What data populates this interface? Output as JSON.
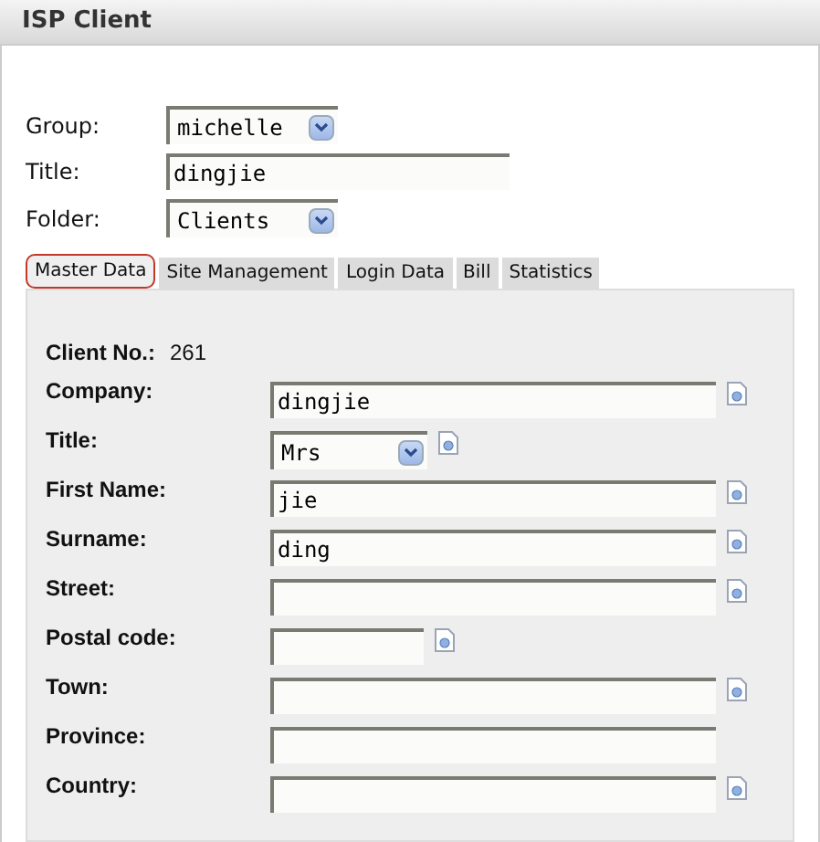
{
  "window": {
    "title": "ISP Client"
  },
  "top_fields": [
    {
      "kind": "select",
      "label": "Group:",
      "value": "michelle"
    },
    {
      "kind": "text",
      "label": "Title:",
      "value": "dingjie"
    },
    {
      "kind": "select",
      "label": "Folder:",
      "value": "Clients"
    }
  ],
  "tabs": [
    {
      "label": "Master Data",
      "selected": true
    },
    {
      "label": "Site Management",
      "selected": false
    },
    {
      "label": "Login Data",
      "selected": false
    },
    {
      "label": "Bill",
      "selected": false
    },
    {
      "label": "Statistics",
      "selected": false
    }
  ],
  "client_no": {
    "label": "Client No.:",
    "value": "261"
  },
  "fields": [
    {
      "kind": "text",
      "label": "Company:",
      "value": "dingjie",
      "info": true
    },
    {
      "kind": "select",
      "label": "Title:",
      "value": "Mrs",
      "info": true
    },
    {
      "kind": "text",
      "label": "First Name:",
      "value": "jie",
      "info": true
    },
    {
      "kind": "text",
      "label": "Surname:",
      "value": "ding",
      "info": true
    },
    {
      "kind": "text",
      "label": "Street:",
      "info": true
    },
    {
      "kind": "short",
      "label": "Postal code:",
      "info": true
    },
    {
      "kind": "text",
      "label": "Town:",
      "info": true
    },
    {
      "kind": "text",
      "label": "Province:",
      "info": false
    },
    {
      "kind": "text",
      "label": "Country:",
      "info": true
    }
  ]
}
